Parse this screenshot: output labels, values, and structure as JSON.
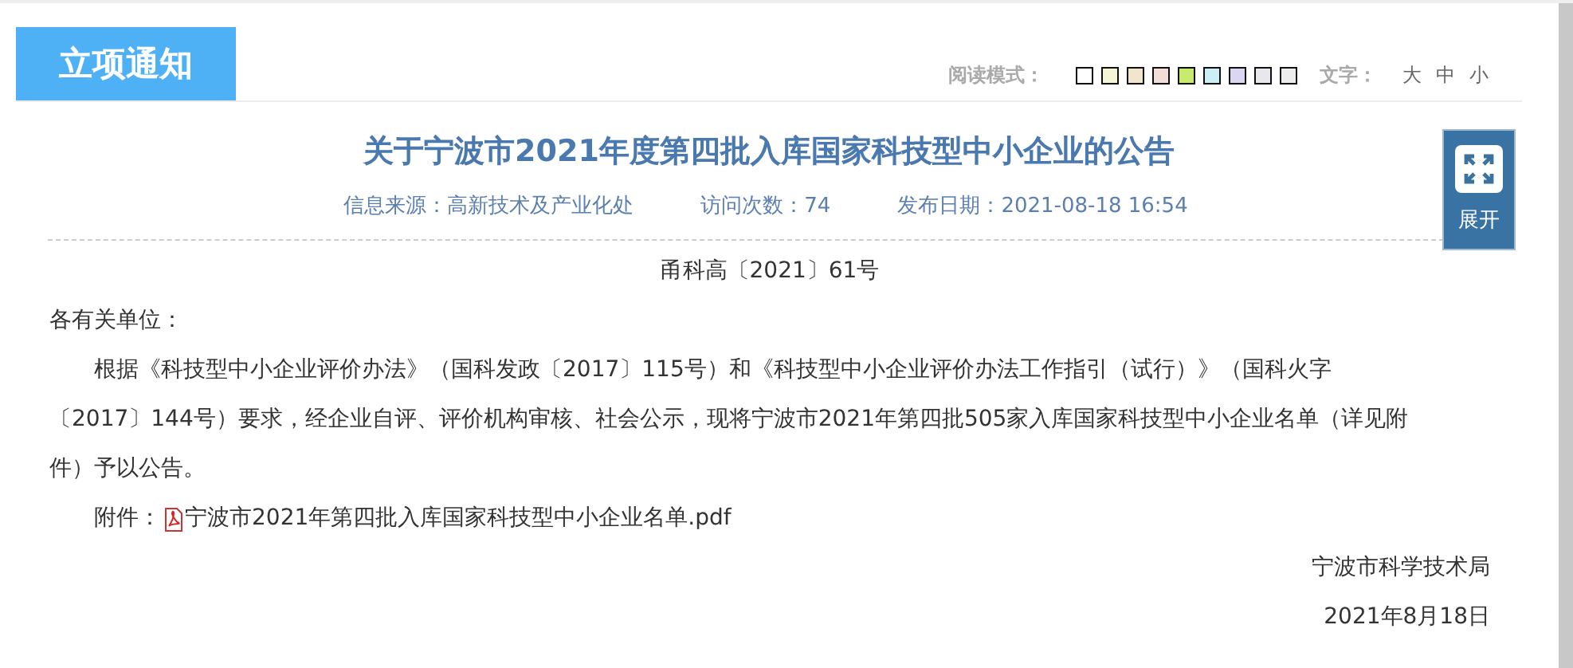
{
  "section_tab": "立项通知",
  "reading_mode": {
    "label": "阅读模式：",
    "swatches": [
      {
        "color": "#ffffff"
      },
      {
        "color": "#f4f6d6"
      },
      {
        "color": "#f2e5cd"
      },
      {
        "color": "#f3ddd8"
      },
      {
        "color": "#c8ea6e"
      },
      {
        "color": "#cdeef5"
      },
      {
        "color": "#dcd6f2"
      },
      {
        "color": "#e8e8ec"
      },
      {
        "color": "#ecedea"
      }
    ]
  },
  "font_size": {
    "label": "文字：",
    "options": [
      "大",
      "中",
      "小"
    ]
  },
  "article": {
    "title": "关于宁波市2021年度第四批入库国家科技型中小企业的公告",
    "meta": [
      "信息来源：高新技术及产业化处",
      "访问次数：74",
      "发布日期：2021-08-18 16:54"
    ],
    "doc_number": "甬科高〔2021〕61号",
    "salutation": "各有关单位：",
    "body": "根据《科技型中小企业评价办法》（国科发政〔2017〕115号）和《科技型中小企业评价办法工作指引（试行）》（国科火字〔2017〕144号）要求，经企业自评、评价机构审核、社会公示，现将宁波市2021年第四批505家入库国家科技型中小企业名单（详见附件）予以公告。",
    "attachment_label": "附件：",
    "attachment": "宁波市2021年第四批入库国家科技型中小企业名单.pdf",
    "signature": "宁波市科学技术局",
    "date": "2021年8月18日"
  },
  "expand_button": "展开"
}
